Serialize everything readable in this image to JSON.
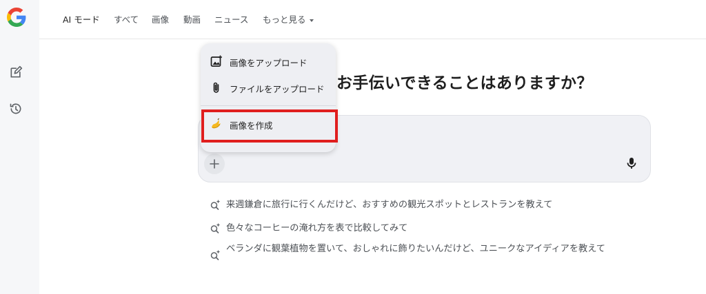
{
  "nav": {
    "tabs": [
      {
        "label": "AI モード",
        "active": true
      },
      {
        "label": "すべて"
      },
      {
        "label": "画像"
      },
      {
        "label": "動画"
      },
      {
        "label": "ニュース"
      },
      {
        "label": "もっと見る"
      }
    ]
  },
  "sidebar": {
    "items": [
      {
        "icon": "google-logo-icon"
      },
      {
        "icon": "new-chat-icon"
      },
      {
        "icon": "history-icon"
      }
    ]
  },
  "main": {
    "heading": "お手伝いできることはありますか？"
  },
  "upload_menu": {
    "items": [
      {
        "icon": "add-image-icon",
        "label": "画像をアップロード"
      },
      {
        "icon": "paperclip-icon",
        "label": "ファイルをアップロード"
      },
      {
        "icon": "banana-icon",
        "label": "画像を作成",
        "highlighted": true
      }
    ]
  },
  "input": {
    "plus_icon": "plus-icon",
    "mic_icon": "mic-icon"
  },
  "suggestions": [
    {
      "text": "来週鎌倉に旅行に行くんだけど、おすすめの観光スポットとレストランを教えて"
    },
    {
      "text": "色々なコーヒーの淹れ方を表で比較してみて"
    },
    {
      "text": "ベランダに観葉植物を置いて、おしゃれに飾りたいんだけど、ユニークなアイディアを教えて"
    }
  ],
  "colors": {
    "highlight_border": "#e01e1e",
    "google_blue": "#4285F4",
    "google_red": "#EA4335",
    "google_yellow": "#FBBC05",
    "google_green": "#34A853"
  }
}
